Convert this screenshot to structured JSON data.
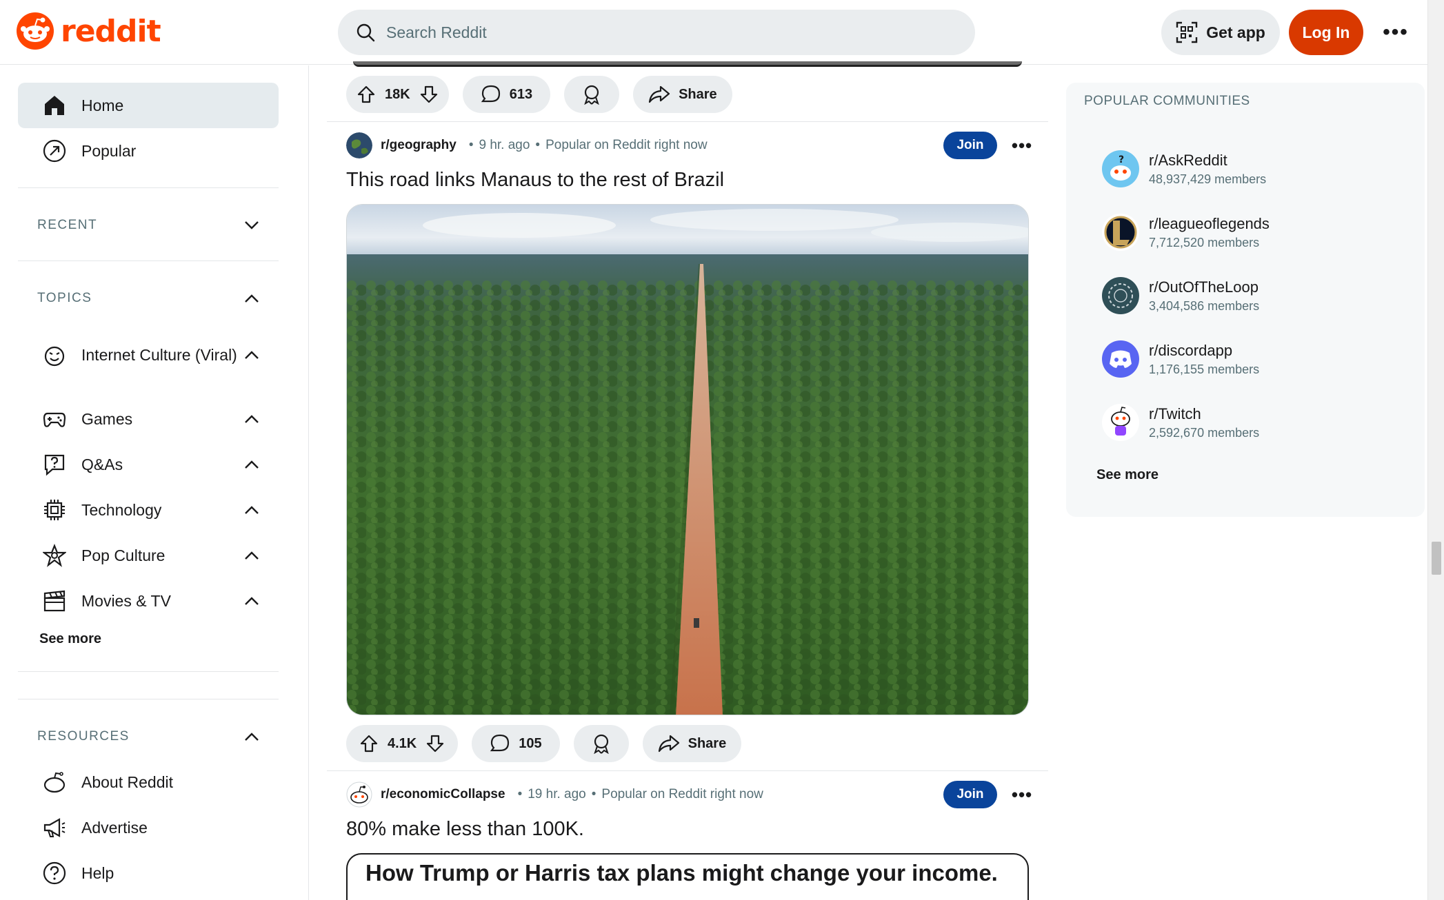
{
  "header": {
    "logo_text": "reddit",
    "search_placeholder": "Search Reddit",
    "get_app_label": "Get app",
    "login_label": "Log In",
    "more_label": "•••"
  },
  "sidebar": {
    "nav": [
      {
        "label": "Home",
        "icon": "home-icon",
        "active": true
      },
      {
        "label": "Popular",
        "icon": "popular-icon",
        "active": false
      }
    ],
    "recent_label": "RECENT",
    "topics_label": "TOPICS",
    "topics": [
      {
        "label": "Internet Culture (Viral)",
        "icon": "smile-icon"
      },
      {
        "label": "Games",
        "icon": "gamepad-icon"
      },
      {
        "label": "Q&As",
        "icon": "question-bubble-icon"
      },
      {
        "label": "Technology",
        "icon": "chip-icon"
      },
      {
        "label": "Pop Culture",
        "icon": "star-icon"
      },
      {
        "label": "Movies & TV",
        "icon": "clapper-icon"
      }
    ],
    "topics_see_more": "See more",
    "resources_label": "RESOURCES",
    "resources": [
      {
        "label": "About Reddit",
        "icon": "reddit-icon"
      },
      {
        "label": "Advertise",
        "icon": "megaphone-icon"
      },
      {
        "label": "Help",
        "icon": "help-icon"
      }
    ]
  },
  "feed": {
    "prev_post_actions": {
      "votes": "18K",
      "comments": "613",
      "share": "Share"
    },
    "posts": [
      {
        "subreddit": "r/geography",
        "time": "9 hr. ago",
        "context": "Popular on Reddit right now",
        "join_label": "Join",
        "more_label": "•••",
        "title": "This road links Manaus to the rest of Brazil",
        "votes": "4.1K",
        "comments": "105",
        "share": "Share"
      },
      {
        "subreddit": "r/economicCollapse",
        "time": "19 hr. ago",
        "context": "Popular on Reddit right now",
        "join_label": "Join",
        "more_label": "•••",
        "title": "80% make less than 100K.",
        "image_headline": "How Trump or Harris tax plans might change your income."
      }
    ]
  },
  "right_sidebar": {
    "title": "POPULAR COMMUNITIES",
    "communities": [
      {
        "name": "r/AskReddit",
        "members": "48,937,429 members",
        "color": "#6ec6f0"
      },
      {
        "name": "r/leagueoflegends",
        "members": "7,712,520 members",
        "color": "#c8a45a"
      },
      {
        "name": "r/OutOfTheLoop",
        "members": "3,404,586 members",
        "color": "#2f4f57"
      },
      {
        "name": "r/discordapp",
        "members": "1,176,155 members",
        "color": "#5865f2"
      },
      {
        "name": "r/Twitch",
        "members": "2,592,670 members",
        "color": "#9146ff"
      }
    ],
    "see_more": "See more"
  },
  "colors": {
    "brand": "#ff4500",
    "login": "#d93900",
    "join": "#0a449b"
  }
}
